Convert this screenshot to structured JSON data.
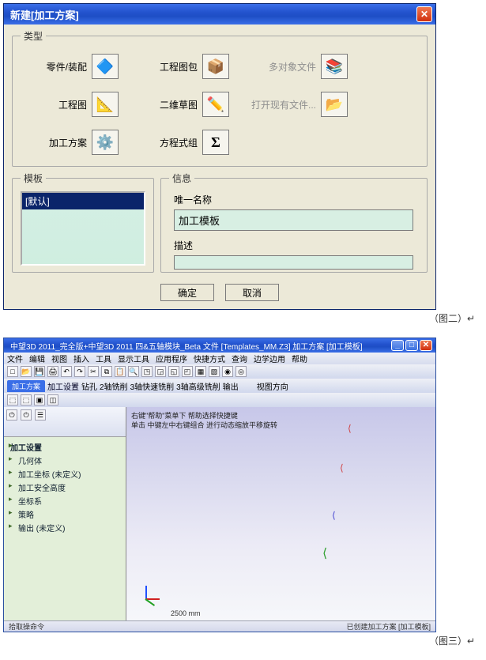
{
  "dialog1": {
    "title": "新建[加工方案]",
    "close_x": "✕",
    "groups": {
      "type": "类型",
      "template": "模板",
      "info": "信息"
    },
    "types": {
      "row1": {
        "a": "零件/装配",
        "b": "工程图包",
        "c": "多对象文件"
      },
      "row2": {
        "a": "工程图",
        "b": "二维草图",
        "c": "打开现有文件..."
      },
      "row3": {
        "a": "加工方案",
        "b": "方程式组"
      }
    },
    "icons": {
      "part": "🔷",
      "pkg": "📦",
      "multi": "📚",
      "draw": "📐",
      "sketch": "✏️",
      "open": "📂",
      "mach": "⚙️",
      "eqn": "Σ"
    },
    "template_item": "[默认]",
    "info": {
      "name_label": "唯一名称",
      "name_value": "加工模板",
      "desc_label": "描述",
      "desc_value": ""
    },
    "buttons": {
      "ok": "确定",
      "cancel": "取消"
    },
    "caption": "（图二）↵"
  },
  "app": {
    "title": "中望3D 2011_完全版+中望3D 2011 四&五轴模块_Beta    文件 [Templates_MM.Z3]    加工方案 [加工模板]",
    "menus": [
      "文件",
      "编辑",
      "视图",
      "插入",
      "工具",
      "显示工具",
      "应用程序",
      "快捷方式",
      "查询",
      "边学边用",
      "帮助"
    ],
    "tab": "加工方案",
    "toolbar2": [
      "加工设置",
      "钻孔",
      "2轴铣削",
      "3轴快速铣削",
      "3轴高级铣削",
      "输出"
    ],
    "toolbar3": [
      "视图方向"
    ],
    "tree": {
      "root": "加工设置",
      "items": [
        "几何体",
        "加工坐标 (未定义)",
        "加工安全高度",
        "坐标系",
        "策略",
        "输出 (未定义)"
      ]
    },
    "hint1": "右键\"帮助\"菜单下 帮助选择快捷键",
    "hint2": "单击 中键左中右键组合 进行动态缩放平移旋转",
    "ruler": "2500 mm",
    "status_left": "拾取操命令",
    "status_mid": "已创建加工方案 [加工模板]",
    "caption": "（图三）↵"
  }
}
